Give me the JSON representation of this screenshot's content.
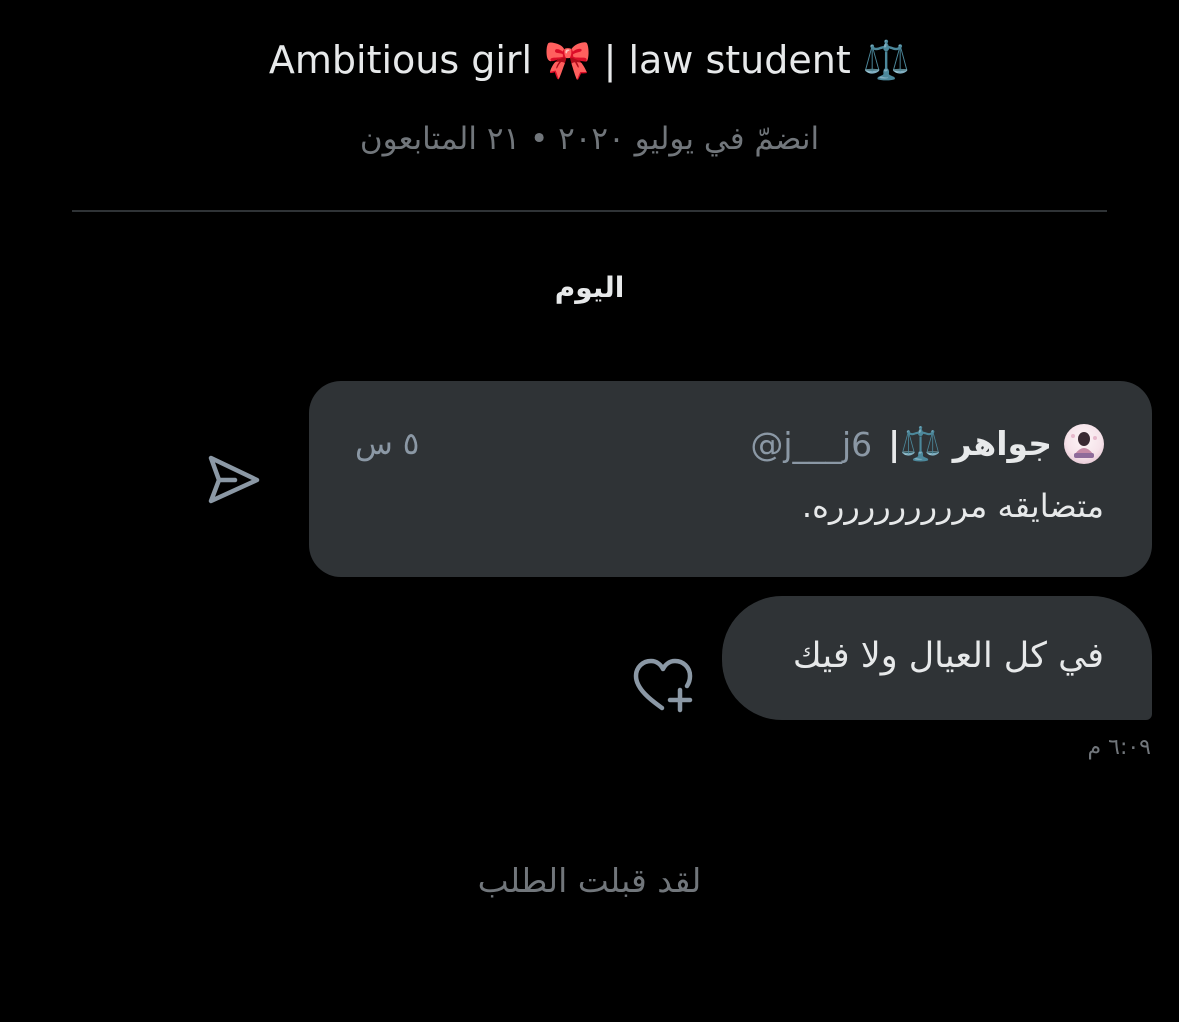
{
  "profile": {
    "bio": "Ambitious girl 🎀 | law student ⚖️",
    "joined_meta": "انضمّ في يوليو ٢٠٢٠ • ٢١ المتابعون"
  },
  "conversation": {
    "day_label": "اليوم",
    "shared_post": {
      "time": "٥ س",
      "display_name": "جواهر ⚖️|",
      "handle": "@j___j6",
      "text": "متضايقه مررررررررره."
    },
    "message": {
      "text": "في كل العيال ولا فيك",
      "time": "٦:٠٩ م"
    },
    "status": "لقد قبلت الطلب"
  },
  "icons": {
    "share": "share-send-icon",
    "react": "heart-plus-icon"
  },
  "colors": {
    "background": "#000000",
    "bubble": "#2f3336",
    "text_primary": "#e7e9ea",
    "text_secondary": "#71767b"
  }
}
